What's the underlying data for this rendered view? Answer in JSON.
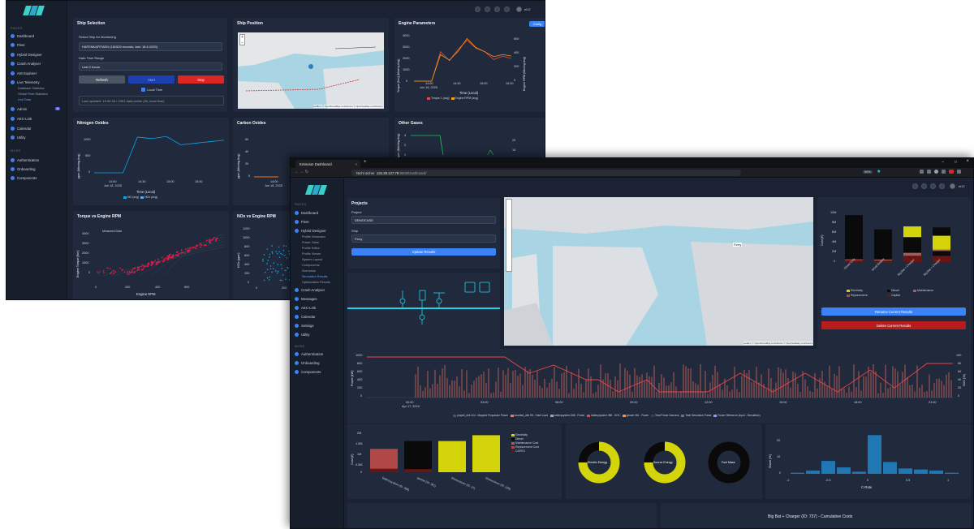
{
  "back": {
    "sidebar": {
      "pages_label": "PAGES",
      "more_label": "MORE",
      "items": [
        "Dashboard",
        "Fleet",
        "Hybrid Designer",
        "Crash Analyser",
        "AIS Explorer",
        "Live Telemetry"
      ],
      "subitems": [
        "Database Statistics",
        "Global Fleet Statistics",
        "Live Data"
      ],
      "items2": [
        "Admin",
        "AEC-Link",
        "Calendar",
        "Utility"
      ],
      "admin_badge": "4",
      "items3": [
        "Authentication",
        "Onboarding",
        "Components"
      ]
    },
    "user": "ei12",
    "ship_selection": {
      "title": "Ship Selection",
      "select_label": "Select Ship for Monitoring",
      "ship_value": "HAFENKAPITAEN (181520 records, last: 18.6.2025)",
      "range_label": "Date Time Range",
      "range_value": "Last 2 hours",
      "refresh": "Refresh",
      "start": "Start",
      "stop": "Stop",
      "local_time": "Local Time",
      "status": "Last updated: 15:40:28 • 2301 data points (5h, local time)"
    },
    "ship_position": {
      "title": "Ship Position",
      "attribution": "Leaflet | © OpenStreetMap contributors © OpenSeaMap contributors"
    },
    "engine_params": {
      "title": "Engine Parameters",
      "config": "Config",
      "ylabel_left": "Torque [Nm] (Moving Avg)",
      "ylabel_right": "Engine RPM (Moving Avg)",
      "xlabel": "Time (Local)",
      "x_ticks": [
        "14:00",
        "14:30",
        "15:00",
        "15:30"
      ],
      "x_sub": "Jun 18, 2025",
      "y_ticks": [
        "0",
        "1000",
        "2000",
        "3000",
        "4000"
      ],
      "y2_ticks": [
        "0",
        "200",
        "400",
        "600"
      ],
      "legend": [
        "Torque 1 (avg)",
        "Engine RPM (avg)"
      ]
    },
    "nox": {
      "title": "Nitrogen Oxides",
      "ylabel": "ppm (Moving Avg)",
      "xlabel": "Time (Local)",
      "x_ticks": [
        "14:00",
        "14:30",
        "15:00",
        "15:30"
      ],
      "x_sub": "Jun 18, 2025",
      "y_ticks": [
        "0",
        "500",
        "1000"
      ],
      "legend": [
        "NO (avg)",
        "NOx (avg)"
      ]
    },
    "co": {
      "title": "Carbon Oxides",
      "ylabel": "ppm (Moving Avg)",
      "y_ticks": [
        "0",
        "20",
        "40",
        "60"
      ],
      "x_ticks": [
        "14:00"
      ],
      "x_sub": "Jun 18, 2025",
      "legend": [
        "CO"
      ]
    },
    "other": {
      "title": "Other Gases",
      "ylabel": "ppm (Moving Avg)",
      "y_ticks": [
        "0",
        "2",
        "4"
      ],
      "y2_ticks": [
        "10",
        "20"
      ]
    },
    "torque_rpm": {
      "title": "Torque vs Engine RPM",
      "ylabel": "Engine Torque [Nm]",
      "xlabel": "Engine RPM",
      "legend": "Measured Data",
      "x_ticks": [
        "0",
        "200",
        "400",
        "600"
      ],
      "y_ticks": [
        "0",
        "1000",
        "2000",
        "3000",
        "4000"
      ]
    },
    "nox_rpm": {
      "title": "NOx vs Engine RPM",
      "ylabel": "NOx (ppm)",
      "y_ticks": [
        "0",
        "200",
        "400",
        "600",
        "800",
        "1000",
        "1200"
      ],
      "x_ticks": [
        "0",
        "200"
      ]
    }
  },
  "front": {
    "browser": {
      "tab": "Emission Dashboard",
      "insecure": "Nicht sicher",
      "url": "134.28.127.78",
      "url_rest": ":8000/Dashboard/",
      "zoom": "90%"
    },
    "sidebar": {
      "pages_label": "PAGES",
      "more_label": "MORE",
      "items": [
        "Dashboard",
        "Fleet",
        "Hybrid Designer"
      ],
      "subitems": [
        "Profile Generator",
        "Power Table",
        "Profile Editor",
        "Profile Viewer",
        "System Layout",
        "Components",
        "Scenarios",
        "Simulation Results",
        "Optimization Results"
      ],
      "items2": [
        "Crash Analyser",
        "Messages",
        "AEC-Link",
        "Calendar",
        "Settings",
        "Utility"
      ],
      "items3": [
        "Authentication",
        "Onboarding",
        "Components"
      ]
    },
    "user": "ei12",
    "projects": {
      "title": "Projects",
      "project_label": "Project",
      "project_value": "DEMOCASE",
      "ship_label": "Ship",
      "ship_value": "Ferry",
      "update": "Update Results"
    },
    "map": {
      "label": "Ferry",
      "attribution": "Leaflet | © OpenStreetMap contributors © OpenSeaMap contributors"
    },
    "cost_panel": {
      "ylabel": "Cost (€)",
      "y_ticks": [
        "0",
        "2M",
        "4M",
        "6M",
        "8M",
        "10M"
      ],
      "categories": [
        "Diesel Only",
        "Small Battery",
        "Big Bat + Charger",
        "Big Bat + Charger"
      ],
      "legend": [
        "Electricity",
        "Diesel",
        "Maintenance",
        "Replacement",
        "Capital"
      ],
      "rename": "Rename Current Results",
      "delete": "Delete Current Results"
    },
    "power": {
      "ylabel_left": "Power [kW]",
      "ylabel_right": "SOC [%]",
      "y_ticks": [
        "0",
        "200",
        "400",
        "600",
        "800",
        "1000"
      ],
      "y2_ticks": [
        "0",
        "20",
        "40",
        "60",
        "80",
        "100"
      ],
      "x_ticks": [
        "00:00",
        "03:00",
        "06:00",
        "09:00",
        "12:00",
        "15:00",
        "18:00",
        "21:00"
      ],
      "x_sub": "Apr 17, 2024",
      "legend": [
        "propell_dirk 314 - Mapped Propulsion Power",
        "boarded_dirk 98 - Hotel Load",
        "batterysystem 368 - Power",
        "batterysystem 368 - SOC",
        "genset 361 - Power",
        "Total Power Demand",
        "Total Simulation Power",
        "Power Difference (Input - Simulation)"
      ]
    },
    "capex": {
      "ylabel": "Cost (€)",
      "y_ticks": [
        "0",
        "0.5M",
        "1M",
        "1.5M",
        "2M"
      ],
      "categories": [
        "batterysystem (ID: 368)",
        "genset (ID: 361)",
        "shoreconver (ID: 37)",
        "shoreconver (ID: 235)"
      ],
      "legend": [
        "Electricity",
        "Diesel",
        "Maintenance Cost",
        "Replacement Cost",
        "CAPEX"
      ]
    },
    "donuts": [
      "Electric Energy",
      "Source Energy",
      "Fuel Mass"
    ],
    "crate": {
      "ylabel": "Share (%)",
      "xlabel": "C-Rate",
      "x_ticks": [
        "-1",
        "-0.5",
        "0",
        "0.5",
        "1"
      ],
      "y_ticks": [
        "0",
        "10",
        "20"
      ]
    },
    "cumulative_title": "Big Bat + Charger (ID: 737) - Cumulative Costs"
  },
  "chart_data": [
    {
      "type": "line",
      "title": "Engine Parameters",
      "xlabel": "Time (Local)",
      "series": [
        {
          "name": "Torque 1 (avg)",
          "values": [
            0,
            0,
            0,
            2600,
            1800,
            2800,
            3600,
            2900,
            2600,
            1900,
            2200,
            2000
          ]
        },
        {
          "name": "Engine RPM (avg)",
          "values": [
            0,
            0,
            0,
            380,
            300,
            430,
            610,
            480,
            420,
            350,
            380,
            360
          ]
        }
      ],
      "x": [
        "13:30",
        "13:45",
        "14:00",
        "14:10",
        "14:20",
        "14:30",
        "14:40",
        "14:50",
        "15:00",
        "15:15",
        "15:30",
        "15:40"
      ],
      "ylim": [
        0,
        4000
      ]
    },
    {
      "type": "line",
      "title": "Nitrogen Oxides",
      "xlabel": "Time (Local)",
      "series": [
        {
          "name": "NO (avg)",
          "values": [
            0,
            0,
            0,
            1150,
            1100,
            1170,
            900,
            950,
            1000,
            1050
          ]
        }
      ],
      "x": [
        "13:40",
        "13:55",
        "14:10",
        "14:22",
        "14:35",
        "14:50",
        "15:05",
        "15:20",
        "15:35",
        "15:45"
      ],
      "ylim": [
        0,
        1200
      ]
    },
    {
      "type": "bar",
      "title": "",
      "ylabel": "Cost (€)",
      "categories": [
        "Diesel Only",
        "Small Battery",
        "Big Bat + Charger",
        "Big Bat + Charger"
      ],
      "values": [
        9.5,
        6.6,
        7.2,
        7.0
      ]
    },
    {
      "type": "bar",
      "title": "",
      "ylabel": "Cost (€)",
      "categories": [
        "batterysystem (ID: 368)",
        "genset (ID: 361)",
        "shoreconver (ID: 37)",
        "shoreconver (ID: 235)"
      ],
      "values": [
        1.2,
        1.6,
        1.6,
        1.9
      ],
      "ylim": [
        0,
        2
      ]
    },
    {
      "type": "bar",
      "title": "",
      "xlabel": "C-Rate",
      "ylabel": "Share (%)",
      "categories": [
        "-1",
        "-0.8",
        "-0.6",
        "-0.4",
        "-0.2",
        "0",
        "0.2",
        "0.4",
        "0.6",
        "0.8",
        "1"
      ],
      "values": [
        1,
        3,
        12,
        6,
        2,
        36,
        11,
        5,
        4,
        3,
        1
      ]
    }
  ]
}
